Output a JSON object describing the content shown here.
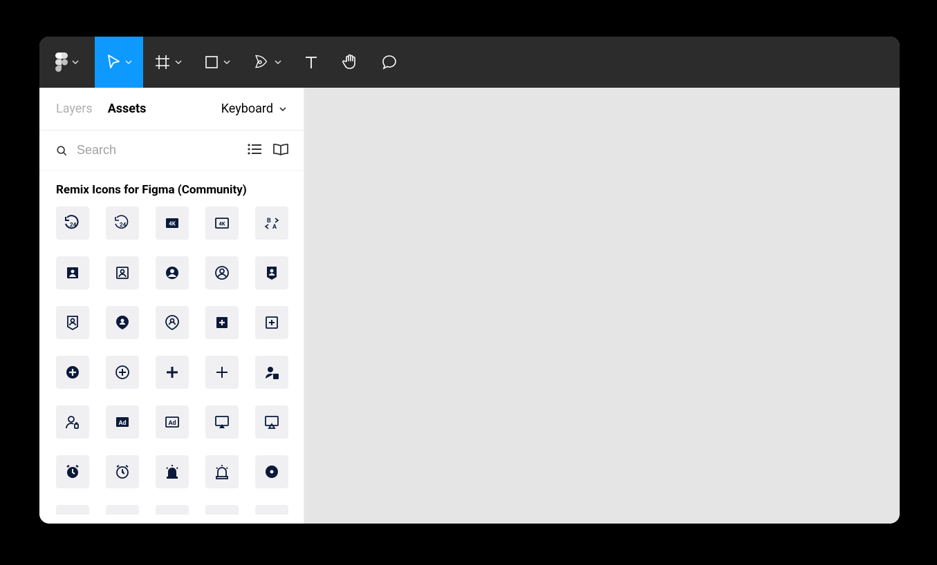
{
  "colors": {
    "accent": "#0d99ff",
    "toolbar_bg": "#2c2c2c",
    "icon_color": "#0b1a3a"
  },
  "toolbar": {
    "tools": [
      {
        "name": "main-menu",
        "has_chevron": true
      },
      {
        "name": "move-tool",
        "has_chevron": true,
        "active": true
      },
      {
        "name": "frame-tool",
        "has_chevron": true
      },
      {
        "name": "shape-tool",
        "has_chevron": true
      },
      {
        "name": "pen-tool",
        "has_chevron": true
      },
      {
        "name": "text-tool",
        "has_chevron": false
      },
      {
        "name": "hand-tool",
        "has_chevron": false
      },
      {
        "name": "comment-tool",
        "has_chevron": false
      }
    ]
  },
  "sidebar": {
    "tabs": {
      "layers": "Layers",
      "assets": "Assets"
    },
    "page_name": "Keyboard",
    "search_placeholder": "Search",
    "library_title": "Remix Icons for Figma (Community)",
    "assets": [
      "24-hours-fill",
      "24-hours-line",
      "4k-fill",
      "4k-line",
      "ab-icon",
      "account-box-fill",
      "account-box-line",
      "account-circle-fill",
      "account-circle-line",
      "account-pin-box-fill",
      "account-pin-box-line",
      "account-pin-circle-fill",
      "account-pin-circle-line",
      "add-box-fill",
      "add-box-line",
      "add-circle-fill",
      "add-circle-line",
      "add-fill",
      "add-line",
      "admin-fill",
      "admin-line",
      "advertisement-fill",
      "advertisement-line",
      "airplay-fill",
      "airplay-line",
      "alarm-fill",
      "alarm-line",
      "alarm-warning-fill",
      "alarm-warning-line",
      "album-fill"
    ]
  }
}
